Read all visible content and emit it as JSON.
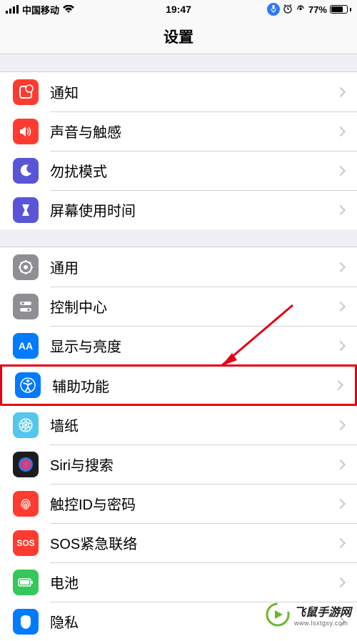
{
  "status": {
    "carrier": "中国移动",
    "time": "19:47",
    "battery_pct": "77%"
  },
  "header": {
    "title": "设置"
  },
  "sections": [
    {
      "items": [
        {
          "key": "notifications",
          "label": "通知"
        },
        {
          "key": "sounds",
          "label": "声音与触感"
        },
        {
          "key": "dnd",
          "label": "勿扰模式"
        },
        {
          "key": "screentime",
          "label": "屏幕使用时间"
        }
      ]
    },
    {
      "items": [
        {
          "key": "general",
          "label": "通用"
        },
        {
          "key": "control",
          "label": "控制中心"
        },
        {
          "key": "display",
          "label": "显示与亮度"
        },
        {
          "key": "accessibility",
          "label": "辅助功能",
          "highlighted": true
        },
        {
          "key": "wallpaper",
          "label": "墙纸"
        },
        {
          "key": "siri",
          "label": "Siri与搜索"
        },
        {
          "key": "touchid",
          "label": "触控ID与密码"
        },
        {
          "key": "sos",
          "label": "SOS紧急联络"
        },
        {
          "key": "battery",
          "label": "电池"
        },
        {
          "key": "privacy",
          "label": "隐私"
        }
      ]
    }
  ],
  "sos_icon_text": "SOS",
  "watermark": {
    "brand": "飞鼠手游网",
    "url": "www.lsxtgsy.com"
  },
  "battery_fill_pct": 77
}
